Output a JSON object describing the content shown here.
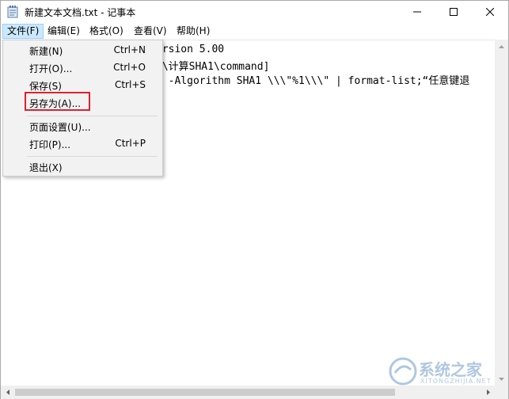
{
  "window": {
    "title": "新建文本文档.txt - 记事本",
    "controls": {
      "minimize": "—",
      "maximize": "☐",
      "close": "✕"
    }
  },
  "menubar": {
    "items": [
      "文件(F)",
      "编辑(E)",
      "格式(O)",
      "查看(V)",
      "帮助(H)"
    ],
    "active_index": 0
  },
  "editor": {
    "lines": [
      "ersion 5.00",
      "1\\计算SHA1\\command]",
      "h -Algorithm SHA1 \\\\\\\"%1\\\\\\\" | format-list;“任意键退"
    ]
  },
  "file_menu": {
    "items": [
      {
        "label": "新建(N)",
        "shortcut": "Ctrl+N"
      },
      {
        "label": "打开(O)...",
        "shortcut": "Ctrl+O"
      },
      {
        "label": "保存(S)",
        "shortcut": "Ctrl+S"
      },
      {
        "label": "另存为(A)...",
        "shortcut": ""
      },
      {
        "label": "页面设置(U)...",
        "shortcut": ""
      },
      {
        "label": "打印(P)...",
        "shortcut": "Ctrl+P"
      },
      {
        "label": "退出(X)",
        "shortcut": ""
      }
    ],
    "highlighted_item": "另存为(A)...",
    "highlight_color": "#e0202c"
  },
  "watermark": {
    "text": "系统之家",
    "sub": "XITONGZHIJIA.NET"
  },
  "colors": {
    "menu_active_bg": "#cce8ff",
    "dropdown_bg": "#f2f2f2"
  }
}
